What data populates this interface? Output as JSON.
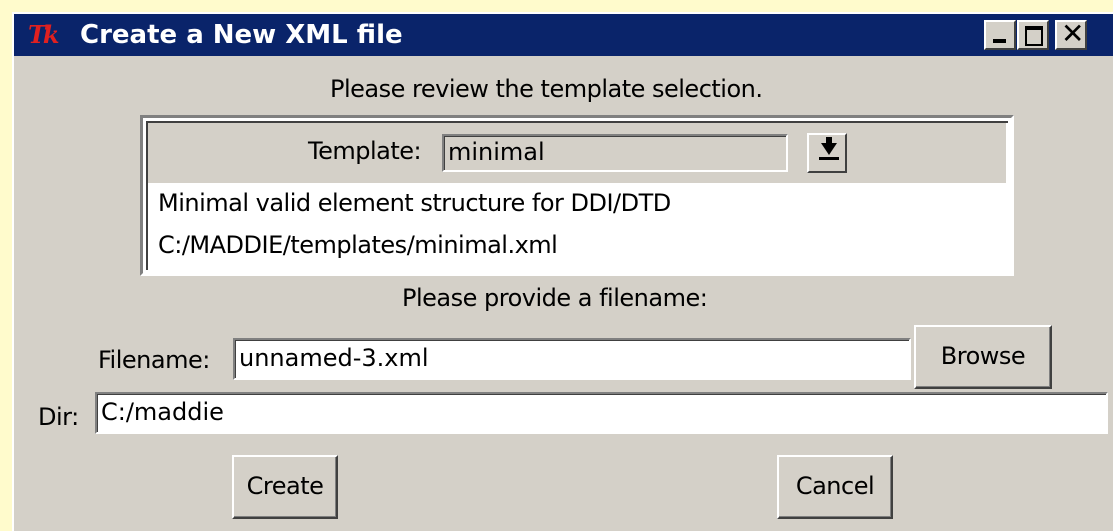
{
  "window": {
    "title": "Create a New XML file",
    "icon_text": "Tk",
    "title_bar_color": "#0a246a",
    "background_color": "#d4d0c8"
  },
  "review_prompt": "Please review the template selection.",
  "template": {
    "label": "Template:",
    "selected": "minimal",
    "description": "Minimal valid element structure for DDI/DTD",
    "path": "C:/MADDIE/templates/minimal.xml"
  },
  "filename_prompt": "Please provide a filename:",
  "filename": {
    "label": "Filename:",
    "value": "unnamed-3.xml",
    "browse_label": "Browse"
  },
  "dir": {
    "label": "Dir:",
    "value": "C:/maddie"
  },
  "actions": {
    "create_label": "Create",
    "cancel_label": "Cancel"
  },
  "icons": [
    "tk-logo-icon",
    "minimize-icon",
    "maximize-icon",
    "close-icon",
    "dropdown-arrow-icon"
  ]
}
